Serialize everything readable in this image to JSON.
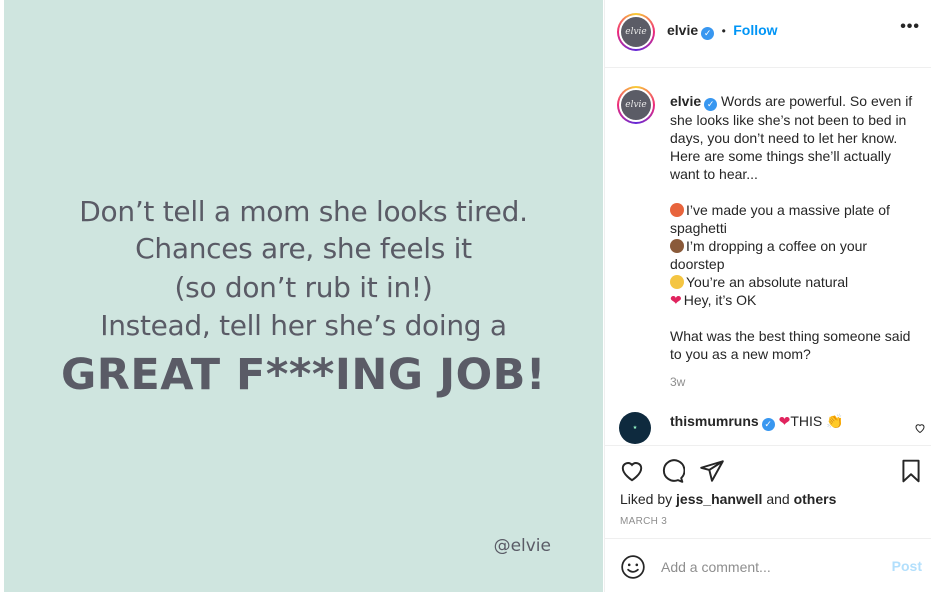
{
  "post_image": {
    "lines": [
      "Don’t tell a mom she looks tired.",
      "Chances are, she feels it",
      "(so don’t rub it in!)",
      "Instead, tell her she’s doing a",
      "GREAT F***ING JOB!"
    ],
    "watermark": "@elvie",
    "background": "#cfe5df",
    "text_color": "#5a5b66"
  },
  "header": {
    "avatar_text": "elvie",
    "username": "elvie",
    "dot": "•",
    "follow_label": "Follow",
    "more_label": "•••"
  },
  "caption": {
    "username": "elvie",
    "intro": "Words are powerful. So even if she looks like she’s not been to bed in days, you don’t need to let her know. Here are some things she’ll actually want to hear...",
    "items": [
      {
        "icon": "spaghetti-emoji",
        "text": "I’ve made you a massive plate of spaghetti"
      },
      {
        "icon": "coffee-emoji",
        "text": "I’m dropping a coffee on your doorstep"
      },
      {
        "icon": "smiling-face-emoji",
        "text": "You’re an absolute natural"
      },
      {
        "icon": "red-heart-emoji",
        "text": "Hey, it’s OK"
      }
    ],
    "question": "What was the best thing someone said to you as a new mom?",
    "time_ago": "3w"
  },
  "comment": {
    "username": "thismumruns",
    "text": "THIS"
  },
  "likes": {
    "prefix": "Liked by",
    "user": "jess_hanwell",
    "and": "and",
    "others": "others"
  },
  "date": "MARCH 3",
  "add_comment": {
    "placeholder": "Add a comment...",
    "post_label": "Post"
  },
  "colors": {
    "accent": "#0095f6",
    "verified": "#3897f0",
    "post_disabled": "#b2dffc"
  }
}
